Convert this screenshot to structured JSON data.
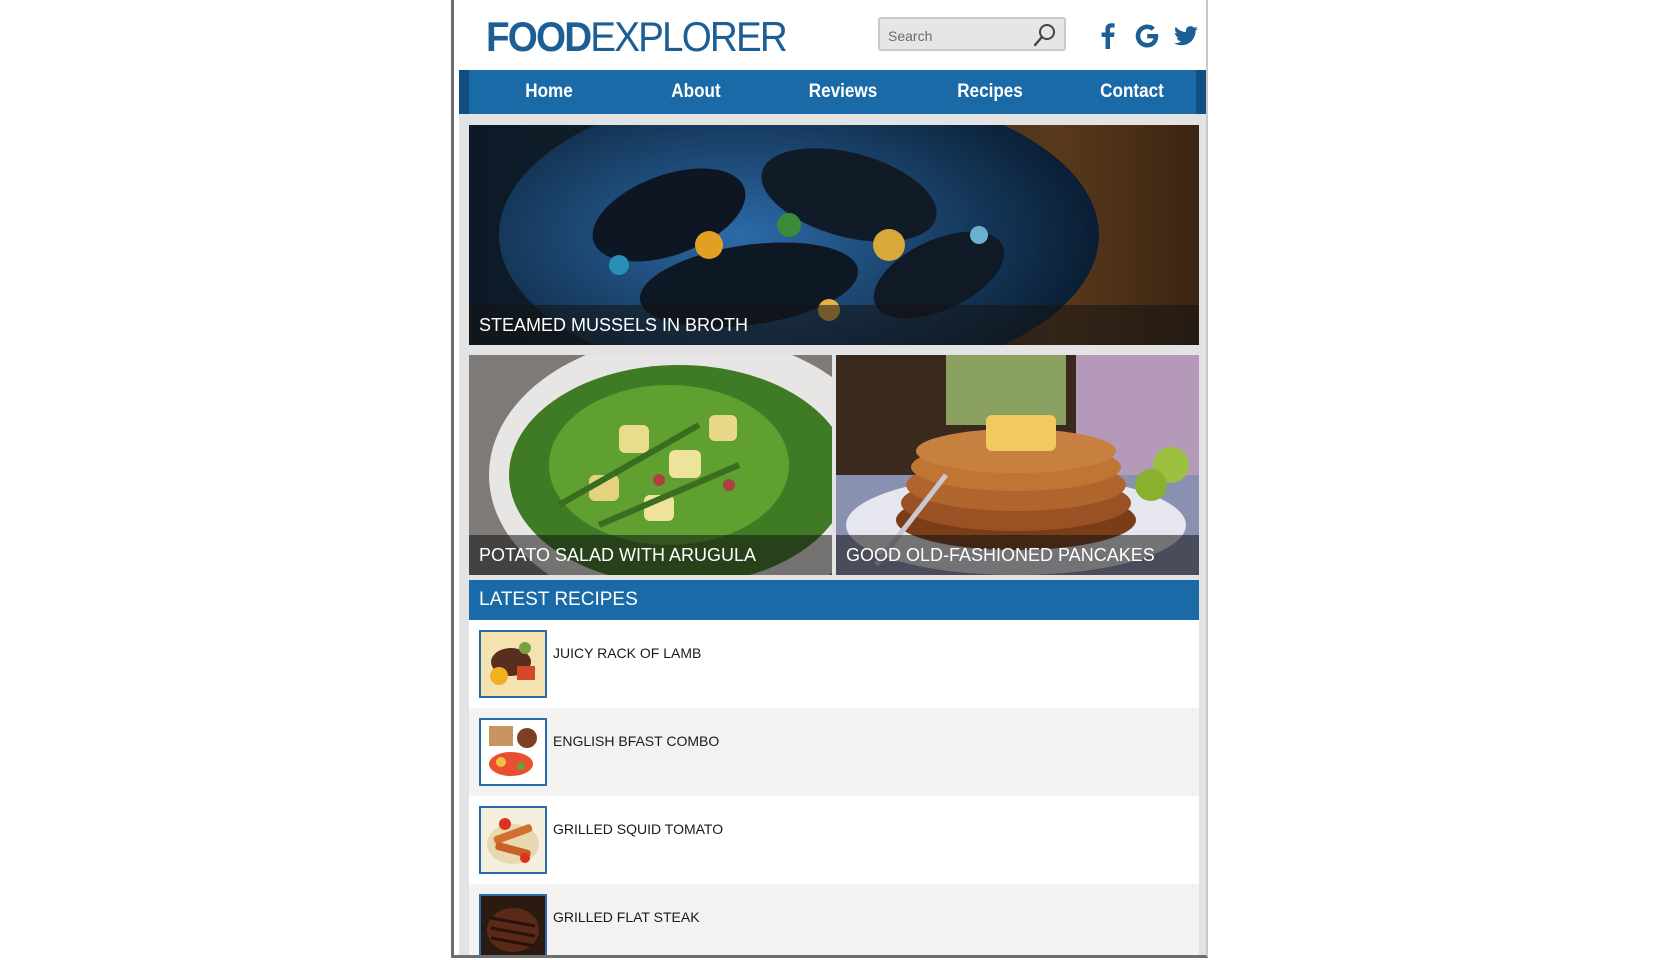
{
  "logo": {
    "bold": "FOOD",
    "light": "EXPLORER"
  },
  "search": {
    "placeholder": "Search"
  },
  "social": [
    "facebook-icon",
    "google-icon",
    "twitter-icon"
  ],
  "nav": [
    "Home",
    "About",
    "Reviews",
    "Recipes",
    "Contact"
  ],
  "features": [
    {
      "caption": "STEAMED MUSSELS IN BROTH"
    },
    {
      "caption": "POTATO SALAD WITH ARUGULA"
    },
    {
      "caption": "GOOD OLD-FASHIONED PANCAKES"
    }
  ],
  "latest": {
    "title": "LATEST RECIPES",
    "items": [
      {
        "label": "JUICY RACK OF LAMB"
      },
      {
        "label": "ENGLISH BFAST COMBO"
      },
      {
        "label": "GRILLED SQUID TOMATO"
      },
      {
        "label": "GRILLED FLAT STEAK"
      }
    ]
  },
  "colors": {
    "brand": "#1d5e95",
    "nav": "#1b6aa8",
    "nav_edge": "#124f80",
    "row_alt": "#f4f2f1"
  }
}
